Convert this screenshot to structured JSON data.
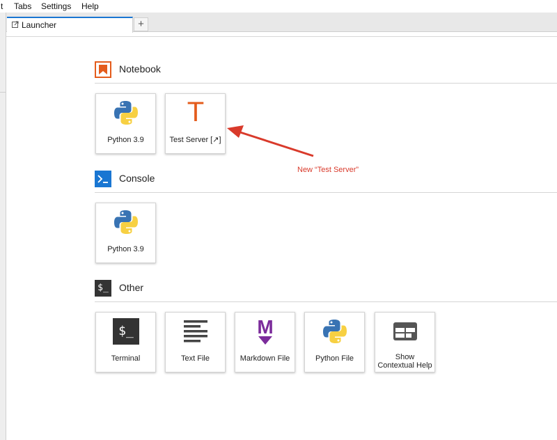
{
  "menubar": {
    "items": [
      "t",
      "Tabs",
      "Settings",
      "Help"
    ]
  },
  "tabs": {
    "active_label": "Launcher",
    "new_tab_label": "+"
  },
  "sections": {
    "notebook": {
      "title": "Notebook"
    },
    "console": {
      "title": "Console",
      "icon_text": ">_"
    },
    "other": {
      "title": "Other",
      "icon_text": "$_"
    }
  },
  "notebook_cards": [
    {
      "label": "Python 3.9",
      "icon": "python-logo-icon"
    },
    {
      "label": "Test Server [↗]",
      "icon": "letter-t-icon",
      "icon_text": "T"
    }
  ],
  "console_cards": [
    {
      "label": "Python 3.9",
      "icon": "python-logo-icon"
    }
  ],
  "other_cards": [
    {
      "label": "Terminal",
      "icon": "terminal-icon",
      "icon_text": "$_"
    },
    {
      "label": "Text File",
      "icon": "text-lines-icon"
    },
    {
      "label": "Markdown File",
      "icon": "markdown-icon",
      "icon_text": "M"
    },
    {
      "label": "Python File",
      "icon": "python-logo-icon"
    },
    {
      "label": "Show Contextual Help",
      "label_lines": [
        "Show",
        "Contextual Help"
      ],
      "icon": "contextual-help-icon"
    }
  ],
  "annotation": {
    "text": "New “Test Server”"
  },
  "colors": {
    "accent_blue": "#1976d2",
    "notebook_orange": "#e45c1c",
    "console_blue": "#1976d2",
    "markdown_purple": "#7b2c9b",
    "annotation_red": "#d93a2b",
    "python_blue": "#3873b3",
    "python_yellow": "#f7d042"
  }
}
